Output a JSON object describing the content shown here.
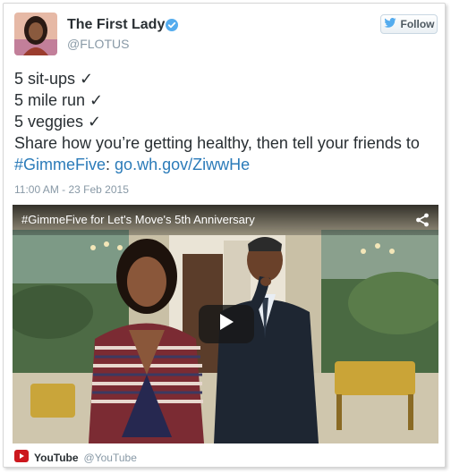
{
  "tweet": {
    "author_name": "The First Lady",
    "author_handle": "@FLOTUS",
    "follow_label": "Follow",
    "lines": [
      "5 sit-ups ✓",
      "5 mile run ✓",
      "5 veggies ✓",
      "Share how you’re getting healthy, then tell your friends to"
    ],
    "hashtag": "#GimmeFive",
    "colon": ":",
    "url": "go.wh.gov/ZiwwHe",
    "timestamp": "11:00 AM - 23 Feb 2015"
  },
  "video": {
    "title": "#GimmeFive for Let's Move's 5th Anniversary"
  },
  "source": {
    "name": "YouTube",
    "handle": "@YouTube"
  },
  "colors": {
    "link": "#2b7bb9",
    "verified": "#55acee",
    "youtube_red": "#cc181e",
    "text": "#292f33",
    "muted": "#8899a6"
  },
  "icons": [
    "verified-badge-icon",
    "twitter-bird-icon",
    "share-icon",
    "play-icon",
    "youtube-logo-icon"
  ]
}
